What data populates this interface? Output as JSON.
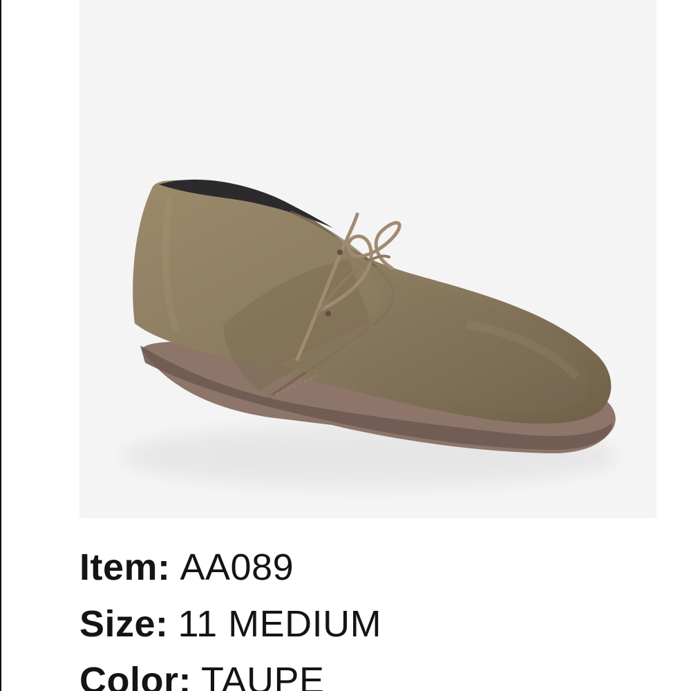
{
  "product_image": {
    "alt": "Taupe suede chukka boot",
    "colors": {
      "background": "#f4f4f4",
      "suede": "#8b7b60",
      "suede_shadow": "#6f6049",
      "sole": "#8d7569",
      "lining": "#2c2a2d"
    }
  },
  "details": [
    {
      "label": "Item:",
      "value": "AA089"
    },
    {
      "label": "Size:",
      "value": "11 MEDIUM"
    },
    {
      "label": "Color:",
      "value": "TAUPE"
    }
  ]
}
